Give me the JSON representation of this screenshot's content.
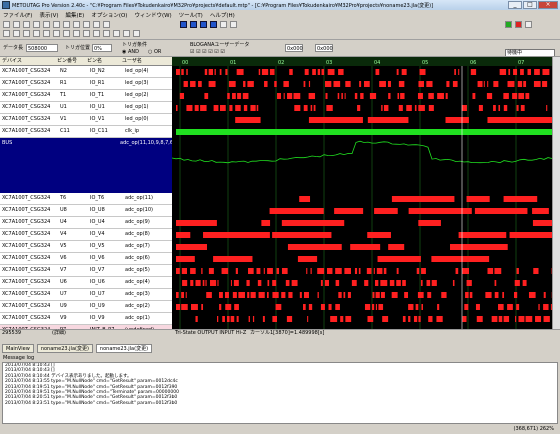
{
  "window": {
    "title": "METOUTAG Pro Version 2.40c - \"C:¥Program Files¥Tokudenkairo¥M32Pro¥projects¥default.mtp\" - [C:¥Program Files¥Tokudenkairo¥M32Pro¥projects¥noname23.jla(変更)]"
  },
  "menu": [
    "ファイル(F)",
    "表示(V)",
    "編集(E)",
    "オプション(O)",
    "ウィンドウ(W)",
    "ツール(T)",
    "ヘルプ(H)"
  ],
  "toolbar": {
    "status_value": "待機中"
  },
  "controls": {
    "data_length_label": "データ長",
    "data_length_value": "508000",
    "trigger_pos_label": "トリガ位置",
    "trigger_pos_value": "0%",
    "trigger_cond_label": "トリガ条件",
    "and_label": "AND",
    "or_label": "OR",
    "blogana_label": "BLOGANAユーザーデータ",
    "field3": "0x000",
    "field4": "0x000"
  },
  "columns": {
    "device": "デバイス",
    "pin_no": "ピン番号",
    "pin_name": "ピン名",
    "user_name": "ユーザ名"
  },
  "rows": [
    {
      "device": "XC7A100T_CSG324",
      "pin": "N2",
      "name": "IO_N2",
      "user": "led_op(4)"
    },
    {
      "device": "XC7A100T_CSG324",
      "pin": "R1",
      "name": "IO_R1",
      "user": "led_op(3)"
    },
    {
      "device": "XC7A100T_CSG324",
      "pin": "T1",
      "name": "IO_T1",
      "user": "led_op(2)"
    },
    {
      "device": "XC7A100T_CSG324",
      "pin": "U1",
      "name": "IO_U1",
      "user": "led_op(1)"
    },
    {
      "device": "XC7A100T_CSG324",
      "pin": "V1",
      "name": "IO_V1",
      "user": "led_op(0)"
    },
    {
      "device": "XC7A100T_CSG324",
      "pin": "C11",
      "name": "IO_C11",
      "user": "clk_ip"
    }
  ],
  "bus": {
    "label": "BUS",
    "user": "adc_op(11,10,9,8,7,6"
  },
  "rows2": [
    {
      "device": "XC7A100T_CSG324",
      "pin": "T6",
      "name": "IO_T6",
      "user": "adc_op(11)"
    },
    {
      "device": "XC7A100T_CSG324",
      "pin": "U8",
      "name": "IO_U8",
      "user": "adc_op(10)"
    },
    {
      "device": "XC7A100T_CSG324",
      "pin": "U4",
      "name": "IO_U4",
      "user": "adc_op(9)"
    },
    {
      "device": "XC7A100T_CSG324",
      "pin": "V4",
      "name": "IO_V4",
      "user": "adc_op(8)"
    },
    {
      "device": "XC7A100T_CSG324",
      "pin": "V5",
      "name": "IO_V5",
      "user": "adc_op(7)"
    },
    {
      "device": "XC7A100T_CSG324",
      "pin": "V6",
      "name": "IO_V6",
      "user": "adc_op(6)"
    },
    {
      "device": "XC7A100T_CSG324",
      "pin": "V7",
      "name": "IO_V7",
      "user": "adc_op(5)"
    },
    {
      "device": "XC7A100T_CSG324",
      "pin": "U6",
      "name": "IO_U6",
      "user": "adc_op(4)"
    },
    {
      "device": "XC7A100T_CSG324",
      "pin": "U7",
      "name": "IO_U7",
      "user": "adc_op(3)"
    },
    {
      "device": "XC7A100T_CSG324",
      "pin": "U9",
      "name": "IO_U9",
      "user": "adc_op(2)"
    },
    {
      "device": "XC7A100T_CSG324",
      "pin": "V9",
      "name": "IO_V9",
      "user": "adc_op(1)"
    },
    {
      "device": "XC7A100T_CSG324",
      "pin": "P7",
      "name": "INIT_B_P7",
      "user": "(undefined)"
    },
    {
      "device": "XC7A100T_CSG324",
      "pin": "P8",
      "name": "CFGBVS_P8",
      "user": "(undefined)"
    }
  ],
  "bottom": {
    "count": "295539",
    "mode": "(詳細)",
    "legend": "Tri-State    OUTPUT    INPUT    Hi-Z",
    "cursor": "カーソル1[3870]=1.489998[s]"
  },
  "tabs": [
    "MainView",
    "noname23.jla(変更)",
    "noname23.jla(変更)"
  ],
  "message_title": "Message log",
  "messages": [
    "2013/07/04 8:10:43  []",
    "2013/07/04 8:10:43  []",
    "2013/07/04 8:10:44  デバイス表示ありました。起動します。",
    "2013/07/04 8:13:55  type=\"M.NullNode\"  cmd=\"GetResult\"  param=0012dc4c",
    "2013/07/04 8:19:51  type=\"M.NullNode\"  cmd=\"GetResult\"  param=0012f390",
    "2013/07/04 8:19:51  type=\"M.NullNode\"  cmd=\"Terminate\"  param=00000000",
    "2013/07/04 8:20:51  type=\"M.NullNode\"  cmd=\"GetResult\"  param=0012f3b0",
    "2013/07/04 8:23:51  type=\"M.NullNode\"  cmd=\"GetResult\"  param=0012f3b0"
  ],
  "status": {
    "coords": "(368,671)  262%"
  },
  "colors": {
    "signal": "#ff2020",
    "clock": "#20e020",
    "grid": "#1a6a1a",
    "bus_bg": "#000080"
  }
}
